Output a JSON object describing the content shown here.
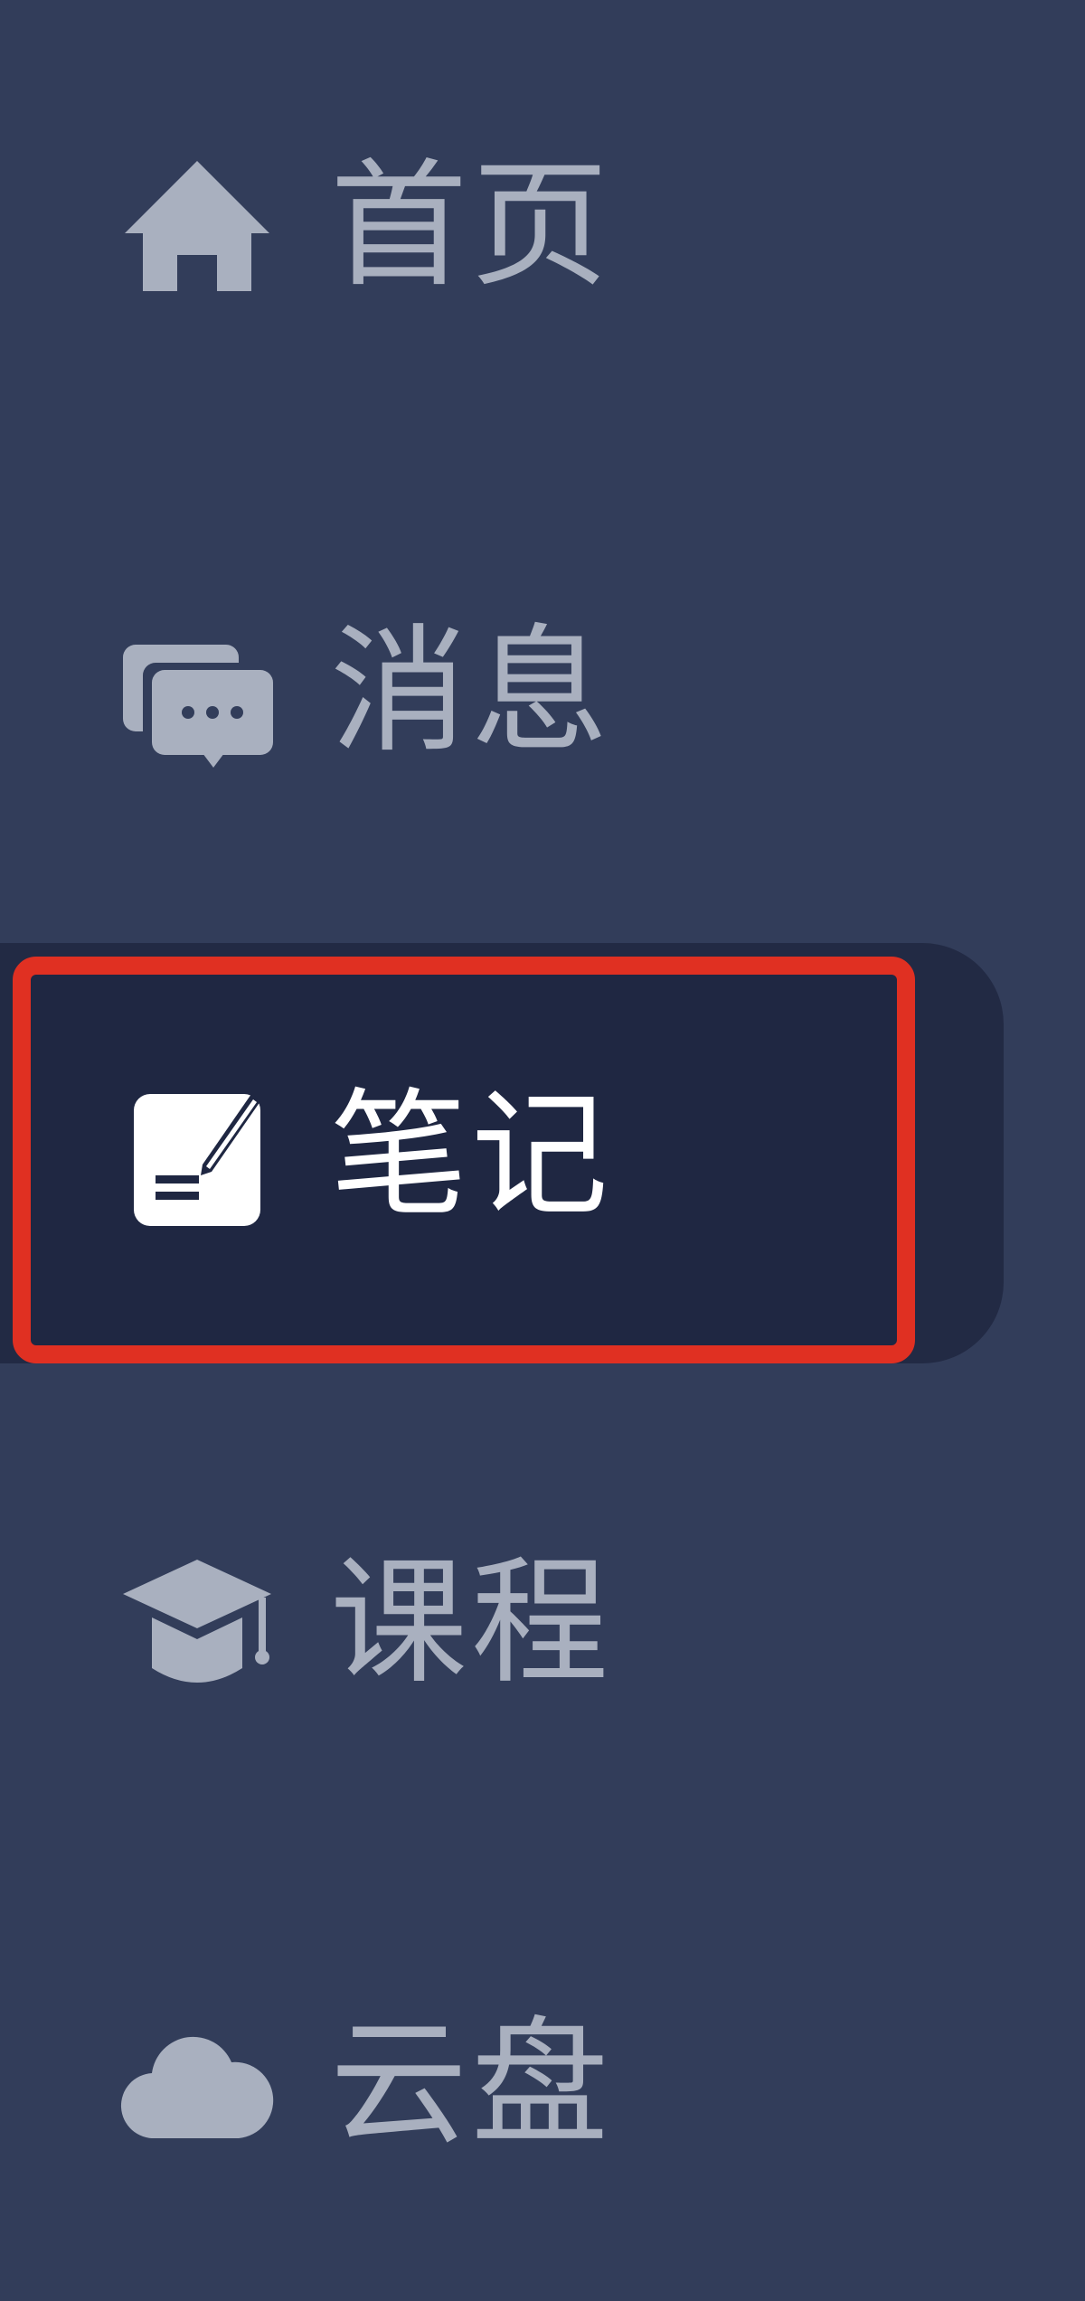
{
  "sidebar": {
    "items": [
      {
        "label": "首页",
        "icon": "home-icon",
        "active": false
      },
      {
        "label": "消息",
        "icon": "chat-bubbles-icon",
        "active": false
      },
      {
        "label": "笔记",
        "icon": "note-edit-icon",
        "active": true
      },
      {
        "label": "课程",
        "icon": "graduation-cap-icon",
        "active": false
      },
      {
        "label": "云盘",
        "icon": "cloud-icon",
        "active": false
      }
    ]
  },
  "colors": {
    "background": "#323d5a",
    "active_background": "#1f2742",
    "inactive_text": "#a9b0bf",
    "active_text": "#ffffff",
    "highlight_border": "#e03022"
  }
}
